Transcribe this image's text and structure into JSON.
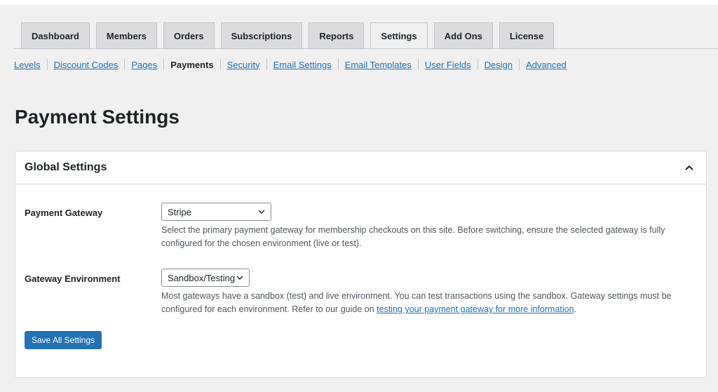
{
  "tabs": [
    {
      "label": "Dashboard"
    },
    {
      "label": "Members"
    },
    {
      "label": "Orders"
    },
    {
      "label": "Subscriptions"
    },
    {
      "label": "Reports"
    },
    {
      "label": "Settings",
      "active": true
    },
    {
      "label": "Add Ons"
    },
    {
      "label": "License"
    }
  ],
  "subnav": [
    {
      "label": "Levels"
    },
    {
      "label": "Discount Codes"
    },
    {
      "label": "Pages"
    },
    {
      "label": "Payments",
      "current": true
    },
    {
      "label": "Security"
    },
    {
      "label": "Email Settings"
    },
    {
      "label": "Email Templates"
    },
    {
      "label": "User Fields"
    },
    {
      "label": "Design"
    },
    {
      "label": "Advanced"
    }
  ],
  "page": {
    "title": "Payment Settings"
  },
  "global_settings": {
    "title": "Global Settings",
    "collapse_icon": "chevron-up-icon",
    "payment_gateway": {
      "label": "Payment Gateway",
      "selected": "Stripe",
      "description": "Select the primary payment gateway for membership checkouts on this site. Before switching, ensure the selected gateway is fully configured for the chosen environment (live or test)."
    },
    "gateway_environment": {
      "label": "Gateway Environment",
      "selected": "Sandbox/Testing",
      "description_before": "Most gateways have a sandbox (test) and live environment. You can test transactions using the sandbox. Gateway settings must be configured for each environment. Refer to our guide on ",
      "description_link": "testing your payment gateway for more information",
      "description_after": "."
    },
    "save_label": "Save All Settings"
  },
  "colors": {
    "accent": "#2271b1",
    "background": "#f0f0f1",
    "card": "#ffffff",
    "text": "#1d2327"
  }
}
